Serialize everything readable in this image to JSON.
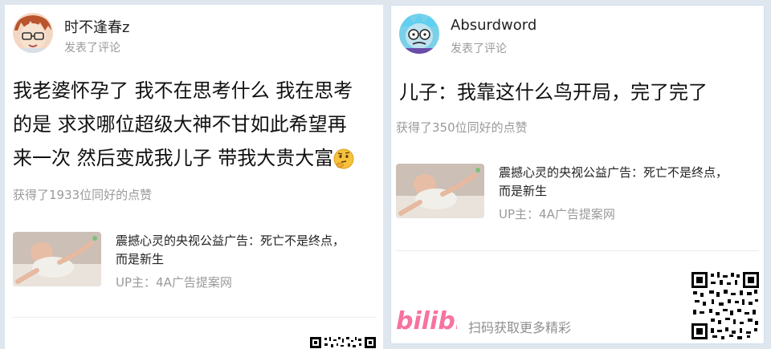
{
  "left_card": {
    "author": "时不逢春z",
    "action": "发表了评论",
    "comment_line1": "我老婆怀孕了 我不在思考什么 我在思考",
    "comment_line2": "的是 求求哪位超级大神不甘如此希望再",
    "comment_line3": "来一次 然后变成我儿子 带我大贵大富",
    "likes": "获得了1933位同好的点赞",
    "video": {
      "title_line1": "震撼心灵的央视公益广告：死亡不是终点，",
      "title_line2": "而是新生",
      "uploader": "UP主：4A广告提案网"
    },
    "icons": {
      "avatar": "anime-avatar-icon",
      "emoji": "thinking-emoji-icon",
      "qr": "qr-code-icon"
    }
  },
  "right_card": {
    "author": "Absurdword",
    "action": "发表了评论",
    "comment": "儿子：我靠这什么鸟开局，完了完了",
    "likes": "获得了350位同好的点赞",
    "video": {
      "title_line1": "震撼心灵的央视公益广告：死亡不是终点，",
      "title_line2": "而是新生",
      "uploader": "UP主：4A广告提案网"
    },
    "footer": {
      "logo": "bilibili",
      "scan_text": "扫码获取更多精彩"
    },
    "icons": {
      "avatar": "cartoon-avatar-icon",
      "qr": "qr-code-icon",
      "logo": "bilibili-logo-icon"
    }
  },
  "colors": {
    "logo_pink": "#f7739f",
    "muted_text": "#9a9a9a",
    "main_text": "#111111"
  }
}
